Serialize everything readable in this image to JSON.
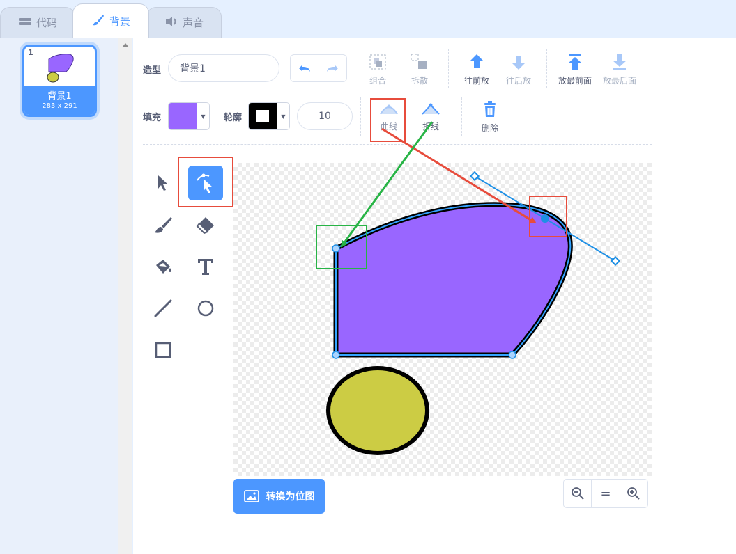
{
  "tabs": [
    {
      "label": "代码",
      "icon": "code-icon"
    },
    {
      "label": "背景",
      "icon": "brush-icon"
    },
    {
      "label": "声音",
      "icon": "speaker-icon"
    }
  ],
  "costume": {
    "index": "1",
    "name": "背景1",
    "size": "283 x 291"
  },
  "toolbar": {
    "costume_label": "造型",
    "costume_name": "背景1",
    "group": "组合",
    "ungroup": "拆散",
    "forward": "往前放",
    "backward": "往后放",
    "front": "放最前面",
    "back": "放最后面",
    "fill_label": "填充",
    "fill_color": "#9966ff",
    "outline_label": "轮廓",
    "outline_color": "#000000",
    "outline_width": "10",
    "curved": "曲线",
    "pointed": "折线",
    "delete": "删除"
  },
  "tools": [
    "select-tool",
    "reshape-tool",
    "brush-tool",
    "eraser-tool",
    "fill-tool",
    "text-tool",
    "line-tool",
    "circle-tool",
    "rect-tool"
  ],
  "convert_bitmap": "转换为位图",
  "zoom": {
    "out": "zoom-out-icon",
    "reset": "=",
    "in": "zoom-in-icon"
  },
  "colors": {
    "accent": "#4c97ff",
    "shape_fill": "#9966ff",
    "ellipse_fill": "#cccc44",
    "highlight_red": "#e74c3c",
    "highlight_green": "#28b446"
  }
}
